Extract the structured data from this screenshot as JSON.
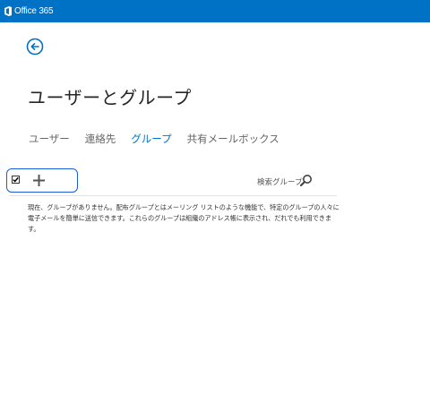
{
  "header": {
    "app_name": "Office 365",
    "bar_color": "#0072c6"
  },
  "navigation": {
    "back_icon": "back-arrow-circle-icon"
  },
  "page": {
    "title": "ユーザーとグループ"
  },
  "tabs": [
    {
      "label": "ユーザー",
      "active": false
    },
    {
      "label": "連絡先",
      "active": false
    },
    {
      "label": "グループ",
      "active": true
    },
    {
      "label": "共有メールボックス",
      "active": false
    }
  ],
  "toolbar": {
    "select_all_checked": true,
    "add_icon": "plus-icon",
    "search_label": "検索グループ",
    "search_icon": "search-icon"
  },
  "main": {
    "empty_message": "現在、グループがありません。配布グループとはメーリング リストのような機能で、特定のグループの人々に電子メールを簡単に送信できます。これらのグループは組織のアドレス帳に表示され、だれでも利用できます。"
  },
  "colors": {
    "accent": "#0072c6",
    "highlight_border": "#1a5fd1"
  }
}
